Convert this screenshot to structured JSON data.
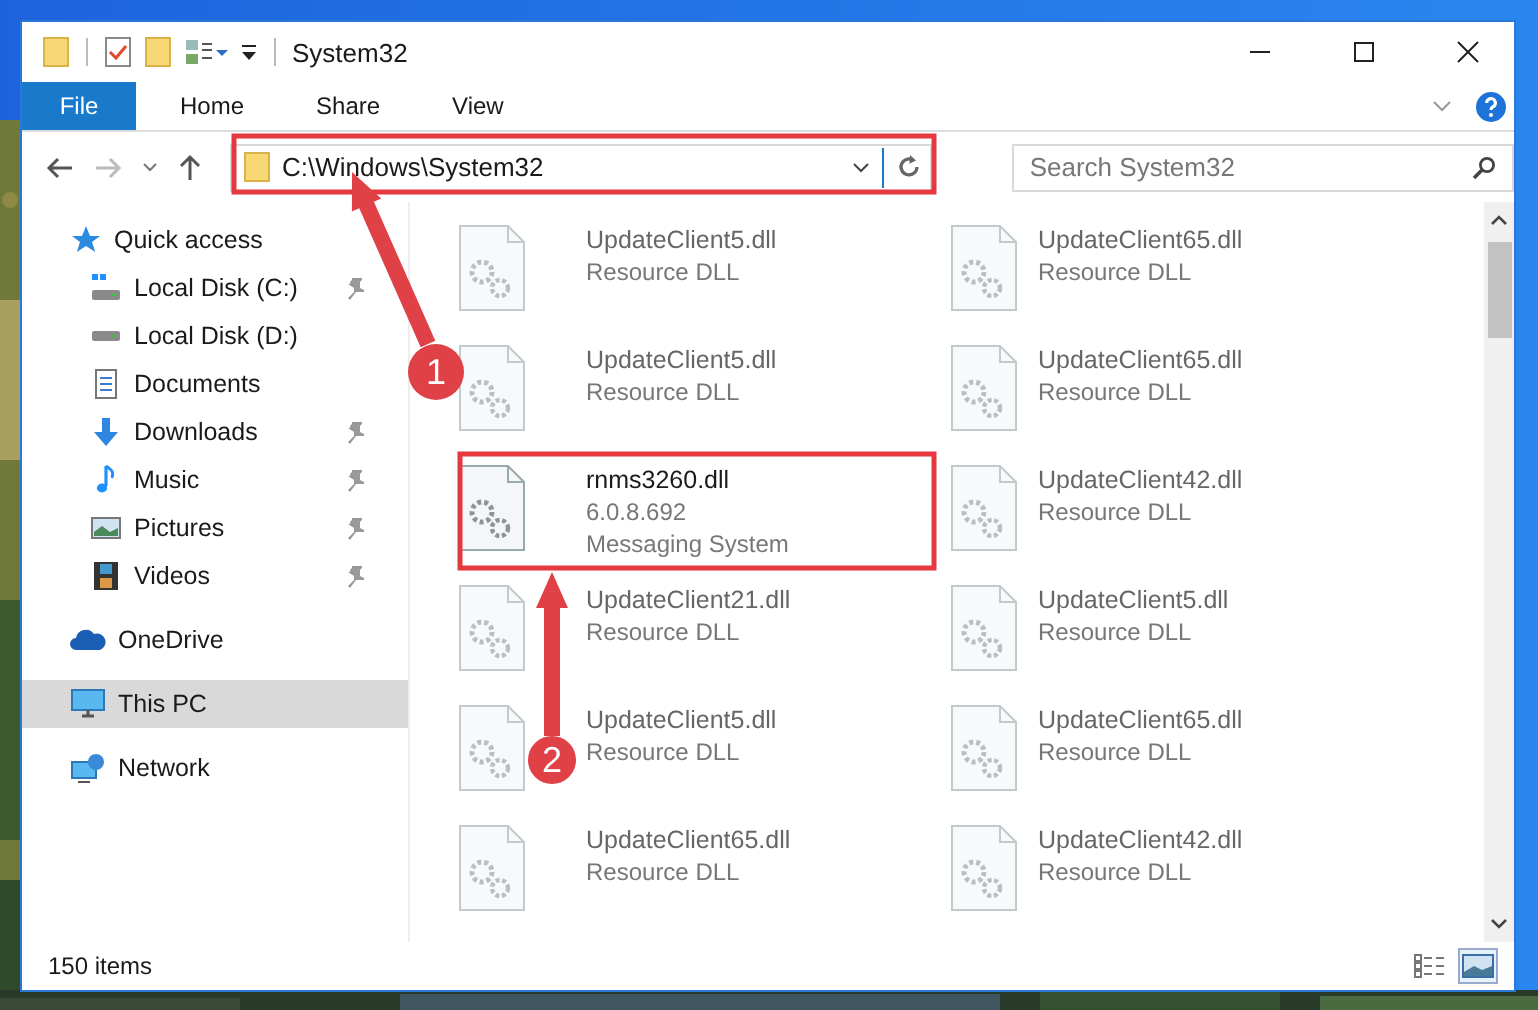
{
  "window": {
    "title": "System32"
  },
  "ribbon": {
    "tabs": [
      {
        "label": "File",
        "selected": true
      },
      {
        "label": "Home",
        "selected": false
      },
      {
        "label": "Share",
        "selected": false
      },
      {
        "label": "View",
        "selected": false
      }
    ]
  },
  "address": {
    "path": "C:\\Windows\\System32"
  },
  "search": {
    "placeholder": "Search System32"
  },
  "sidebar": {
    "items": [
      {
        "label": "Quick access",
        "kind": "star",
        "selected": false,
        "children": [
          {
            "label": "Local Disk (C:)",
            "kind": "system-drive",
            "pinned": true,
            "selected": false
          },
          {
            "label": "Local Disk (D:)",
            "kind": "drive",
            "pinned": false,
            "selected": false
          },
          {
            "label": "Documents",
            "kind": "documents",
            "pinned": false,
            "selected": false
          },
          {
            "label": "Downloads",
            "kind": "downloads",
            "pinned": true,
            "selected": false
          },
          {
            "label": "Music",
            "kind": "music",
            "pinned": true,
            "selected": false
          },
          {
            "label": "Pictures",
            "kind": "pictures",
            "pinned": true,
            "selected": false
          },
          {
            "label": "Videos",
            "kind": "videos",
            "pinned": true,
            "selected": false
          }
        ]
      },
      {
        "label": "OneDrive",
        "kind": "cloud",
        "selected": false
      },
      {
        "label": "This PC",
        "kind": "pc",
        "selected": true
      },
      {
        "label": "Network",
        "kind": "network",
        "selected": false
      }
    ]
  },
  "files": [
    {
      "name": "UpdateClient5.dll",
      "details": [
        "Resource DLL"
      ],
      "kind": "blurred"
    },
    {
      "name": "UpdateClient65.dll",
      "details": [
        "Resource DLL"
      ],
      "kind": "blurred"
    },
    {
      "name": "UpdateClient5.dll",
      "details": [
        "Resource DLL"
      ],
      "kind": "blurred"
    },
    {
      "name": "UpdateClient65.dll",
      "details": [
        "Resource DLL"
      ],
      "kind": "blurred"
    },
    {
      "name": "rnms3260.dll",
      "details": [
        "6.0.8.692",
        "Messaging System"
      ],
      "kind": "focus"
    },
    {
      "name": "UpdateClient42.dll",
      "details": [
        "Resource DLL"
      ],
      "kind": "blurred"
    },
    {
      "name": "UpdateClient21.dll",
      "details": [
        "Resource DLL"
      ],
      "kind": "blurred"
    },
    {
      "name": "UpdateClient5.dll",
      "details": [
        "Resource DLL"
      ],
      "kind": "blurred"
    },
    {
      "name": "UpdateClient5.dll",
      "details": [
        "Resource DLL"
      ],
      "kind": "blurred"
    },
    {
      "name": "UpdateClient65.dll",
      "details": [
        "Resource DLL"
      ],
      "kind": "blurred"
    },
    {
      "name": "UpdateClient65.dll",
      "details": [
        "Resource DLL"
      ],
      "kind": "blurred"
    },
    {
      "name": "UpdateClient42.dll",
      "details": [
        "Resource DLL"
      ],
      "kind": "blurred"
    }
  ],
  "status_bar": {
    "count": "150 items",
    "views": [
      {
        "kind": "details",
        "selected": false
      },
      {
        "kind": "tiles",
        "selected": true
      }
    ]
  },
  "annotations": [
    {
      "label": "1"
    },
    {
      "label": "2"
    }
  ]
}
